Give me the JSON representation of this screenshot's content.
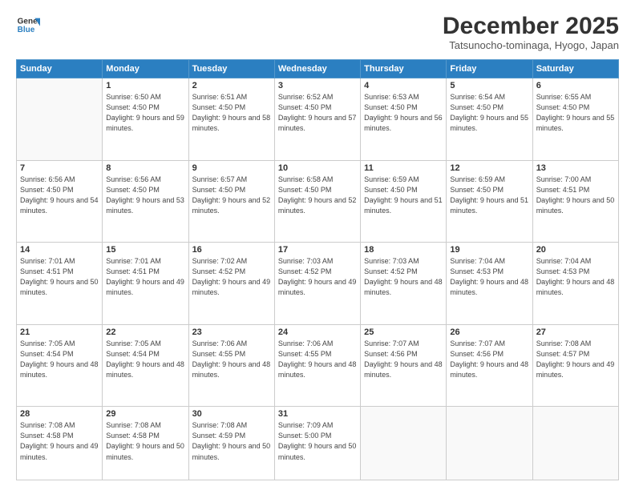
{
  "logo": {
    "line1": "General",
    "line2": "Blue"
  },
  "header": {
    "month": "December 2025",
    "location": "Tatsunocho-tominaga, Hyogo, Japan"
  },
  "weekdays": [
    "Sunday",
    "Monday",
    "Tuesday",
    "Wednesday",
    "Thursday",
    "Friday",
    "Saturday"
  ],
  "weeks": [
    [
      {
        "day": "",
        "sunrise": "",
        "sunset": "",
        "daylight": ""
      },
      {
        "day": "1",
        "sunrise": "Sunrise: 6:50 AM",
        "sunset": "Sunset: 4:50 PM",
        "daylight": "Daylight: 9 hours and 59 minutes."
      },
      {
        "day": "2",
        "sunrise": "Sunrise: 6:51 AM",
        "sunset": "Sunset: 4:50 PM",
        "daylight": "Daylight: 9 hours and 58 minutes."
      },
      {
        "day": "3",
        "sunrise": "Sunrise: 6:52 AM",
        "sunset": "Sunset: 4:50 PM",
        "daylight": "Daylight: 9 hours and 57 minutes."
      },
      {
        "day": "4",
        "sunrise": "Sunrise: 6:53 AM",
        "sunset": "Sunset: 4:50 PM",
        "daylight": "Daylight: 9 hours and 56 minutes."
      },
      {
        "day": "5",
        "sunrise": "Sunrise: 6:54 AM",
        "sunset": "Sunset: 4:50 PM",
        "daylight": "Daylight: 9 hours and 55 minutes."
      },
      {
        "day": "6",
        "sunrise": "Sunrise: 6:55 AM",
        "sunset": "Sunset: 4:50 PM",
        "daylight": "Daylight: 9 hours and 55 minutes."
      }
    ],
    [
      {
        "day": "7",
        "sunrise": "Sunrise: 6:56 AM",
        "sunset": "Sunset: 4:50 PM",
        "daylight": "Daylight: 9 hours and 54 minutes."
      },
      {
        "day": "8",
        "sunrise": "Sunrise: 6:56 AM",
        "sunset": "Sunset: 4:50 PM",
        "daylight": "Daylight: 9 hours and 53 minutes."
      },
      {
        "day": "9",
        "sunrise": "Sunrise: 6:57 AM",
        "sunset": "Sunset: 4:50 PM",
        "daylight": "Daylight: 9 hours and 52 minutes."
      },
      {
        "day": "10",
        "sunrise": "Sunrise: 6:58 AM",
        "sunset": "Sunset: 4:50 PM",
        "daylight": "Daylight: 9 hours and 52 minutes."
      },
      {
        "day": "11",
        "sunrise": "Sunrise: 6:59 AM",
        "sunset": "Sunset: 4:50 PM",
        "daylight": "Daylight: 9 hours and 51 minutes."
      },
      {
        "day": "12",
        "sunrise": "Sunrise: 6:59 AM",
        "sunset": "Sunset: 4:50 PM",
        "daylight": "Daylight: 9 hours and 51 minutes."
      },
      {
        "day": "13",
        "sunrise": "Sunrise: 7:00 AM",
        "sunset": "Sunset: 4:51 PM",
        "daylight": "Daylight: 9 hours and 50 minutes."
      }
    ],
    [
      {
        "day": "14",
        "sunrise": "Sunrise: 7:01 AM",
        "sunset": "Sunset: 4:51 PM",
        "daylight": "Daylight: 9 hours and 50 minutes."
      },
      {
        "day": "15",
        "sunrise": "Sunrise: 7:01 AM",
        "sunset": "Sunset: 4:51 PM",
        "daylight": "Daylight: 9 hours and 49 minutes."
      },
      {
        "day": "16",
        "sunrise": "Sunrise: 7:02 AM",
        "sunset": "Sunset: 4:52 PM",
        "daylight": "Daylight: 9 hours and 49 minutes."
      },
      {
        "day": "17",
        "sunrise": "Sunrise: 7:03 AM",
        "sunset": "Sunset: 4:52 PM",
        "daylight": "Daylight: 9 hours and 49 minutes."
      },
      {
        "day": "18",
        "sunrise": "Sunrise: 7:03 AM",
        "sunset": "Sunset: 4:52 PM",
        "daylight": "Daylight: 9 hours and 48 minutes."
      },
      {
        "day": "19",
        "sunrise": "Sunrise: 7:04 AM",
        "sunset": "Sunset: 4:53 PM",
        "daylight": "Daylight: 9 hours and 48 minutes."
      },
      {
        "day": "20",
        "sunrise": "Sunrise: 7:04 AM",
        "sunset": "Sunset: 4:53 PM",
        "daylight": "Daylight: 9 hours and 48 minutes."
      }
    ],
    [
      {
        "day": "21",
        "sunrise": "Sunrise: 7:05 AM",
        "sunset": "Sunset: 4:54 PM",
        "daylight": "Daylight: 9 hours and 48 minutes."
      },
      {
        "day": "22",
        "sunrise": "Sunrise: 7:05 AM",
        "sunset": "Sunset: 4:54 PM",
        "daylight": "Daylight: 9 hours and 48 minutes."
      },
      {
        "day": "23",
        "sunrise": "Sunrise: 7:06 AM",
        "sunset": "Sunset: 4:55 PM",
        "daylight": "Daylight: 9 hours and 48 minutes."
      },
      {
        "day": "24",
        "sunrise": "Sunrise: 7:06 AM",
        "sunset": "Sunset: 4:55 PM",
        "daylight": "Daylight: 9 hours and 48 minutes."
      },
      {
        "day": "25",
        "sunrise": "Sunrise: 7:07 AM",
        "sunset": "Sunset: 4:56 PM",
        "daylight": "Daylight: 9 hours and 48 minutes."
      },
      {
        "day": "26",
        "sunrise": "Sunrise: 7:07 AM",
        "sunset": "Sunset: 4:56 PM",
        "daylight": "Daylight: 9 hours and 48 minutes."
      },
      {
        "day": "27",
        "sunrise": "Sunrise: 7:08 AM",
        "sunset": "Sunset: 4:57 PM",
        "daylight": "Daylight: 9 hours and 49 minutes."
      }
    ],
    [
      {
        "day": "28",
        "sunrise": "Sunrise: 7:08 AM",
        "sunset": "Sunset: 4:58 PM",
        "daylight": "Daylight: 9 hours and 49 minutes."
      },
      {
        "day": "29",
        "sunrise": "Sunrise: 7:08 AM",
        "sunset": "Sunset: 4:58 PM",
        "daylight": "Daylight: 9 hours and 50 minutes."
      },
      {
        "day": "30",
        "sunrise": "Sunrise: 7:08 AM",
        "sunset": "Sunset: 4:59 PM",
        "daylight": "Daylight: 9 hours and 50 minutes."
      },
      {
        "day": "31",
        "sunrise": "Sunrise: 7:09 AM",
        "sunset": "Sunset: 5:00 PM",
        "daylight": "Daylight: 9 hours and 50 minutes."
      },
      {
        "day": "",
        "sunrise": "",
        "sunset": "",
        "daylight": ""
      },
      {
        "day": "",
        "sunrise": "",
        "sunset": "",
        "daylight": ""
      },
      {
        "day": "",
        "sunrise": "",
        "sunset": "",
        "daylight": ""
      }
    ]
  ]
}
